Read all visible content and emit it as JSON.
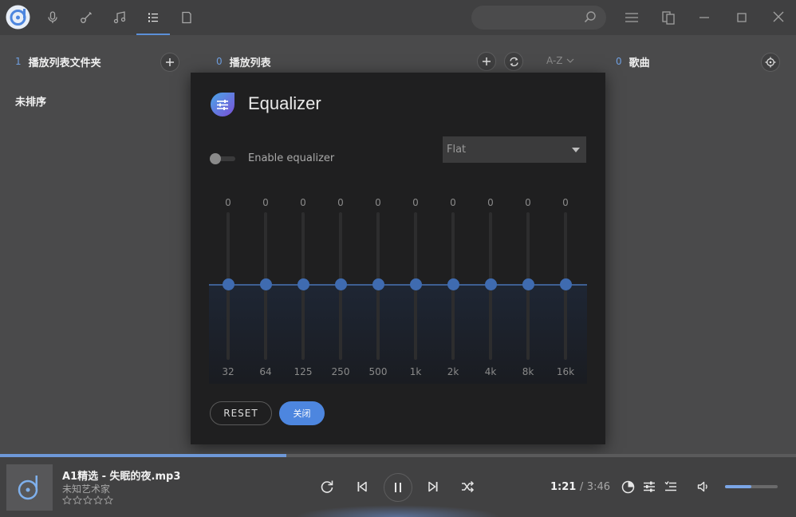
{
  "topbar": {
    "nav_tabs": [
      {
        "icon": "microphone-icon",
        "active": false
      },
      {
        "icon": "guitar-icon",
        "active": false
      },
      {
        "icon": "music-note-icon",
        "active": false
      },
      {
        "icon": "list-icon",
        "active": true
      },
      {
        "icon": "folder-icon",
        "active": false
      }
    ],
    "search": {
      "value": "",
      "placeholder": ""
    }
  },
  "panels": {
    "playlist_folders": {
      "count": "1",
      "title": "播放列表文件夹",
      "items": [
        "未排序"
      ]
    },
    "playlists": {
      "count": "0",
      "title": "播放列表",
      "sort_label": "A-Z"
    },
    "songs": {
      "count": "0",
      "title": "歌曲"
    }
  },
  "equalizer": {
    "title": "Equalizer",
    "toggle_label": "Enable equalizer",
    "enabled": false,
    "preset": "Flat",
    "bands": [
      {
        "freq": "32",
        "value": "0"
      },
      {
        "freq": "64",
        "value": "0"
      },
      {
        "freq": "125",
        "value": "0"
      },
      {
        "freq": "250",
        "value": "0"
      },
      {
        "freq": "500",
        "value": "0"
      },
      {
        "freq": "1k",
        "value": "0"
      },
      {
        "freq": "2k",
        "value": "0"
      },
      {
        "freq": "4k",
        "value": "0"
      },
      {
        "freq": "8k",
        "value": "0"
      },
      {
        "freq": "16k",
        "value": "0"
      }
    ],
    "reset_label": "RESET",
    "close_label": "关闭"
  },
  "player": {
    "title": "A1精选 - 失眠的夜.mp3",
    "artist": "未知艺术家",
    "rating": 0,
    "current_time": "1:21",
    "separator": "/",
    "duration": "3:46",
    "progress": 0.36,
    "volume": 0.5
  },
  "colors": {
    "accent": "#4d86df",
    "background": "#4a4a4b",
    "dialog": "#1f1f20"
  }
}
